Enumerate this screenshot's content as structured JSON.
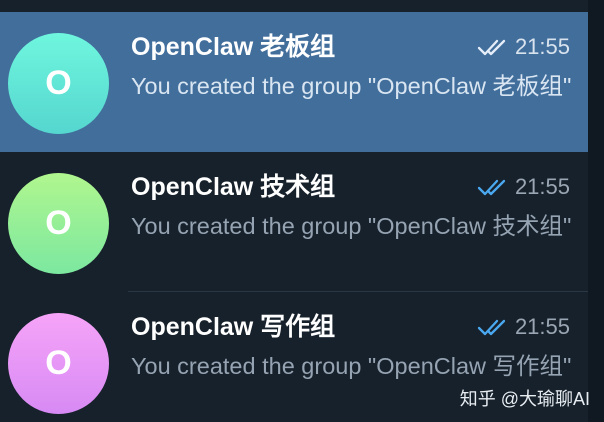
{
  "chats": [
    {
      "avatar_letter": "O",
      "title": "OpenClaw 老板组",
      "time": "21:55",
      "preview": "You created the group \"OpenClaw 老板组\"",
      "selected": true,
      "check_color": "#e5eef8"
    },
    {
      "avatar_letter": "O",
      "title": "OpenClaw 技术组",
      "time": "21:55",
      "preview": "You created the group \"OpenClaw 技术组\"",
      "selected": false,
      "check_color": "#4aa8f0"
    },
    {
      "avatar_letter": "O",
      "title": "OpenClaw 写作组",
      "time": "21:55",
      "preview": "You created the group \"OpenClaw 写作组\"",
      "selected": false,
      "check_color": "#4aa8f0"
    }
  ],
  "icons": {
    "read_status": "double-check-icon"
  },
  "watermark": "知乎 @大瑜聊AI",
  "colors": {
    "background": "#17212b",
    "selected_row": "#426e9c",
    "read_check": "#4aa8f0"
  }
}
